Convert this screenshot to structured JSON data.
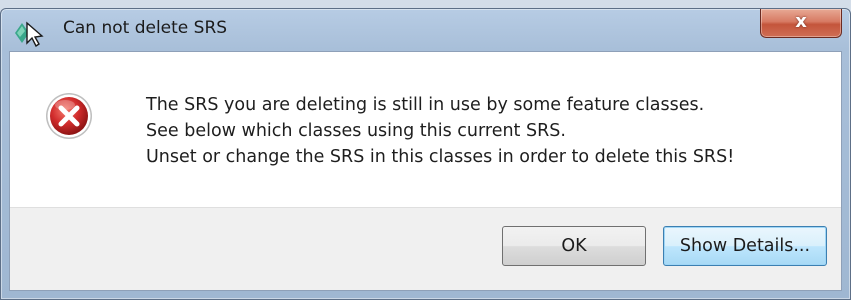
{
  "window": {
    "title": "Can not delete SRS",
    "close_label": "x"
  },
  "dialog": {
    "message_lines": [
      "The SRS you are deleting is still in use by some feature classes.",
      "See below which classes using this current SRS.",
      "Unset or change the SRS in this classes in order to delete this SRS!"
    ],
    "icon": "error-icon"
  },
  "buttons": {
    "ok_label": "OK",
    "details_label": "Show Details..."
  },
  "colors": {
    "error_red": "#d12c2c",
    "focus_blue": "#3c7fb1"
  }
}
